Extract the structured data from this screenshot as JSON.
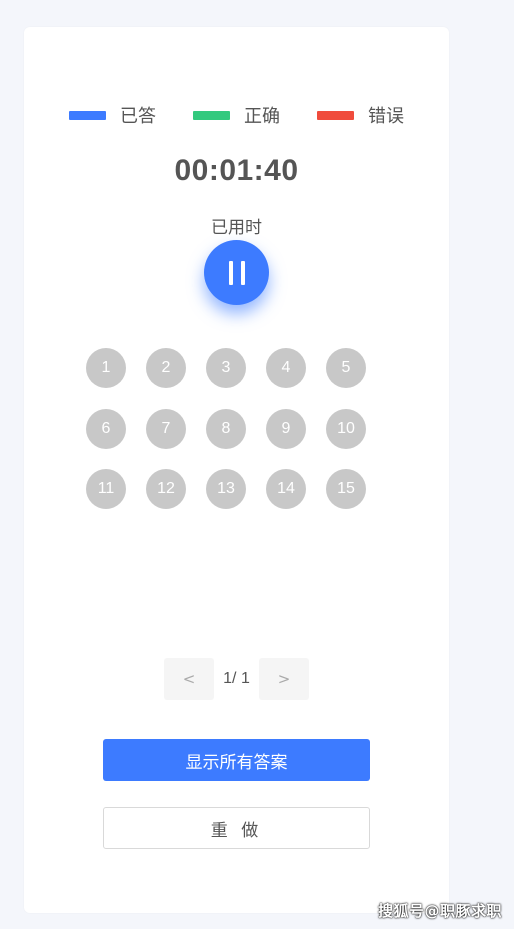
{
  "legend": {
    "items": [
      {
        "label": "已答",
        "color": "#3d7bff"
      },
      {
        "label": "正确",
        "color": "#33c97e"
      },
      {
        "label": "错误",
        "color": "#f04c3c"
      }
    ]
  },
  "timer": {
    "value": "00:01:40",
    "label": "已用时"
  },
  "pause_button": {
    "icon": "pause-icon"
  },
  "questions": [
    "1",
    "2",
    "3",
    "4",
    "5",
    "6",
    "7",
    "8",
    "9",
    "10",
    "11",
    "12",
    "13",
    "14",
    "15"
  ],
  "pagination": {
    "prev_label": "<",
    "next_label": ">",
    "page_text": "1/ 1"
  },
  "actions": {
    "show_answers_label": "显示所有答案",
    "redo_label": "重 做"
  },
  "watermark": {
    "text": "搜狐号@职豚求职"
  }
}
